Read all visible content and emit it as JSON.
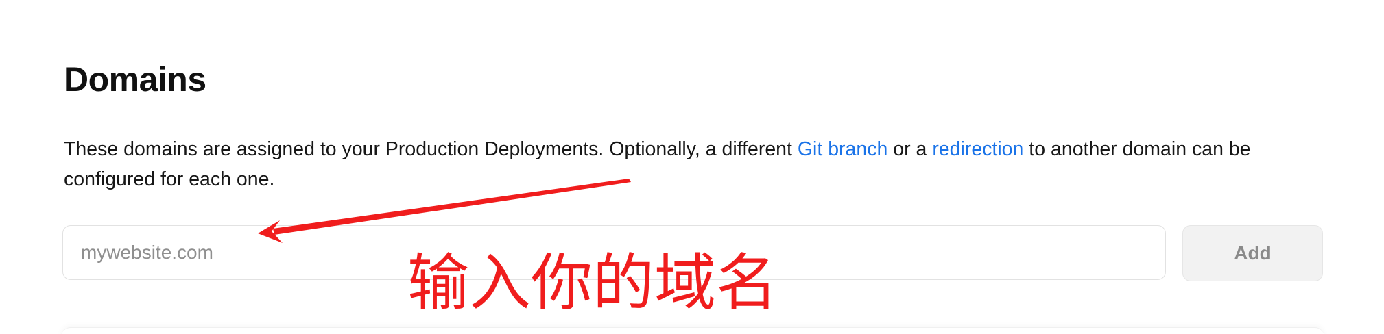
{
  "section": {
    "title": "Domains",
    "description": {
      "text_before_git": "These domains are assigned to your Production Deployments. Optionally, a different ",
      "git_branch_link": "Git branch",
      "text_between": " or a ",
      "redirection_link": "redirection",
      "text_after": " to another domain can be configured for each one."
    }
  },
  "domain_form": {
    "input_value": "",
    "input_placeholder": "mywebsite.com",
    "add_label": "Add"
  },
  "annotation": {
    "text": "输入你的域名",
    "color": "#f01d1d"
  },
  "colors": {
    "link": "#1a73e8",
    "button_bg": "#f2f2f2",
    "button_text": "#8a8a8a"
  }
}
